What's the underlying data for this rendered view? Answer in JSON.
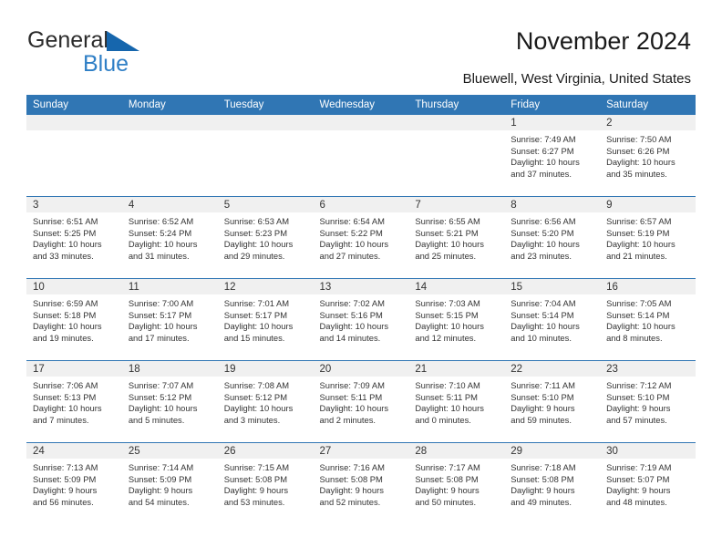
{
  "brand": {
    "line1": "General",
    "line2": "Blue",
    "triangle_color": "#1666ad",
    "blue_text_color": "#2f7fc6"
  },
  "header": {
    "title": "November 2024",
    "subtitle": "Bluewell, West Virginia, United States",
    "accent_color": "#3076b4",
    "daynum_band_color": "#f0f0f0"
  },
  "calendar": {
    "weekday_headers": [
      "Sunday",
      "Monday",
      "Tuesday",
      "Wednesday",
      "Thursday",
      "Friday",
      "Saturday"
    ],
    "weeks": [
      [
        {
          "day": "",
          "empty": true
        },
        {
          "day": "",
          "empty": true
        },
        {
          "day": "",
          "empty": true
        },
        {
          "day": "",
          "empty": true
        },
        {
          "day": "",
          "empty": true
        },
        {
          "day": "1",
          "sunrise": "Sunrise: 7:49 AM",
          "sunset": "Sunset: 6:27 PM",
          "daylight1": "Daylight: 10 hours",
          "daylight2": "and 37 minutes."
        },
        {
          "day": "2",
          "sunrise": "Sunrise: 7:50 AM",
          "sunset": "Sunset: 6:26 PM",
          "daylight1": "Daylight: 10 hours",
          "daylight2": "and 35 minutes."
        }
      ],
      [
        {
          "day": "3",
          "sunrise": "Sunrise: 6:51 AM",
          "sunset": "Sunset: 5:25 PM",
          "daylight1": "Daylight: 10 hours",
          "daylight2": "and 33 minutes."
        },
        {
          "day": "4",
          "sunrise": "Sunrise: 6:52 AM",
          "sunset": "Sunset: 5:24 PM",
          "daylight1": "Daylight: 10 hours",
          "daylight2": "and 31 minutes."
        },
        {
          "day": "5",
          "sunrise": "Sunrise: 6:53 AM",
          "sunset": "Sunset: 5:23 PM",
          "daylight1": "Daylight: 10 hours",
          "daylight2": "and 29 minutes."
        },
        {
          "day": "6",
          "sunrise": "Sunrise: 6:54 AM",
          "sunset": "Sunset: 5:22 PM",
          "daylight1": "Daylight: 10 hours",
          "daylight2": "and 27 minutes."
        },
        {
          "day": "7",
          "sunrise": "Sunrise: 6:55 AM",
          "sunset": "Sunset: 5:21 PM",
          "daylight1": "Daylight: 10 hours",
          "daylight2": "and 25 minutes."
        },
        {
          "day": "8",
          "sunrise": "Sunrise: 6:56 AM",
          "sunset": "Sunset: 5:20 PM",
          "daylight1": "Daylight: 10 hours",
          "daylight2": "and 23 minutes."
        },
        {
          "day": "9",
          "sunrise": "Sunrise: 6:57 AM",
          "sunset": "Sunset: 5:19 PM",
          "daylight1": "Daylight: 10 hours",
          "daylight2": "and 21 minutes."
        }
      ],
      [
        {
          "day": "10",
          "sunrise": "Sunrise: 6:59 AM",
          "sunset": "Sunset: 5:18 PM",
          "daylight1": "Daylight: 10 hours",
          "daylight2": "and 19 minutes."
        },
        {
          "day": "11",
          "sunrise": "Sunrise: 7:00 AM",
          "sunset": "Sunset: 5:17 PM",
          "daylight1": "Daylight: 10 hours",
          "daylight2": "and 17 minutes."
        },
        {
          "day": "12",
          "sunrise": "Sunrise: 7:01 AM",
          "sunset": "Sunset: 5:17 PM",
          "daylight1": "Daylight: 10 hours",
          "daylight2": "and 15 minutes."
        },
        {
          "day": "13",
          "sunrise": "Sunrise: 7:02 AM",
          "sunset": "Sunset: 5:16 PM",
          "daylight1": "Daylight: 10 hours",
          "daylight2": "and 14 minutes."
        },
        {
          "day": "14",
          "sunrise": "Sunrise: 7:03 AM",
          "sunset": "Sunset: 5:15 PM",
          "daylight1": "Daylight: 10 hours",
          "daylight2": "and 12 minutes."
        },
        {
          "day": "15",
          "sunrise": "Sunrise: 7:04 AM",
          "sunset": "Sunset: 5:14 PM",
          "daylight1": "Daylight: 10 hours",
          "daylight2": "and 10 minutes."
        },
        {
          "day": "16",
          "sunrise": "Sunrise: 7:05 AM",
          "sunset": "Sunset: 5:14 PM",
          "daylight1": "Daylight: 10 hours",
          "daylight2": "and 8 minutes."
        }
      ],
      [
        {
          "day": "17",
          "sunrise": "Sunrise: 7:06 AM",
          "sunset": "Sunset: 5:13 PM",
          "daylight1": "Daylight: 10 hours",
          "daylight2": "and 7 minutes."
        },
        {
          "day": "18",
          "sunrise": "Sunrise: 7:07 AM",
          "sunset": "Sunset: 5:12 PM",
          "daylight1": "Daylight: 10 hours",
          "daylight2": "and 5 minutes."
        },
        {
          "day": "19",
          "sunrise": "Sunrise: 7:08 AM",
          "sunset": "Sunset: 5:12 PM",
          "daylight1": "Daylight: 10 hours",
          "daylight2": "and 3 minutes."
        },
        {
          "day": "20",
          "sunrise": "Sunrise: 7:09 AM",
          "sunset": "Sunset: 5:11 PM",
          "daylight1": "Daylight: 10 hours",
          "daylight2": "and 2 minutes."
        },
        {
          "day": "21",
          "sunrise": "Sunrise: 7:10 AM",
          "sunset": "Sunset: 5:11 PM",
          "daylight1": "Daylight: 10 hours",
          "daylight2": "and 0 minutes."
        },
        {
          "day": "22",
          "sunrise": "Sunrise: 7:11 AM",
          "sunset": "Sunset: 5:10 PM",
          "daylight1": "Daylight: 9 hours",
          "daylight2": "and 59 minutes."
        },
        {
          "day": "23",
          "sunrise": "Sunrise: 7:12 AM",
          "sunset": "Sunset: 5:10 PM",
          "daylight1": "Daylight: 9 hours",
          "daylight2": "and 57 minutes."
        }
      ],
      [
        {
          "day": "24",
          "sunrise": "Sunrise: 7:13 AM",
          "sunset": "Sunset: 5:09 PM",
          "daylight1": "Daylight: 9 hours",
          "daylight2": "and 56 minutes."
        },
        {
          "day": "25",
          "sunrise": "Sunrise: 7:14 AM",
          "sunset": "Sunset: 5:09 PM",
          "daylight1": "Daylight: 9 hours",
          "daylight2": "and 54 minutes."
        },
        {
          "day": "26",
          "sunrise": "Sunrise: 7:15 AM",
          "sunset": "Sunset: 5:08 PM",
          "daylight1": "Daylight: 9 hours",
          "daylight2": "and 53 minutes."
        },
        {
          "day": "27",
          "sunrise": "Sunrise: 7:16 AM",
          "sunset": "Sunset: 5:08 PM",
          "daylight1": "Daylight: 9 hours",
          "daylight2": "and 52 minutes."
        },
        {
          "day": "28",
          "sunrise": "Sunrise: 7:17 AM",
          "sunset": "Sunset: 5:08 PM",
          "daylight1": "Daylight: 9 hours",
          "daylight2": "and 50 minutes."
        },
        {
          "day": "29",
          "sunrise": "Sunrise: 7:18 AM",
          "sunset": "Sunset: 5:08 PM",
          "daylight1": "Daylight: 9 hours",
          "daylight2": "and 49 minutes."
        },
        {
          "day": "30",
          "sunrise": "Sunrise: 7:19 AM",
          "sunset": "Sunset: 5:07 PM",
          "daylight1": "Daylight: 9 hours",
          "daylight2": "and 48 minutes."
        }
      ]
    ]
  }
}
